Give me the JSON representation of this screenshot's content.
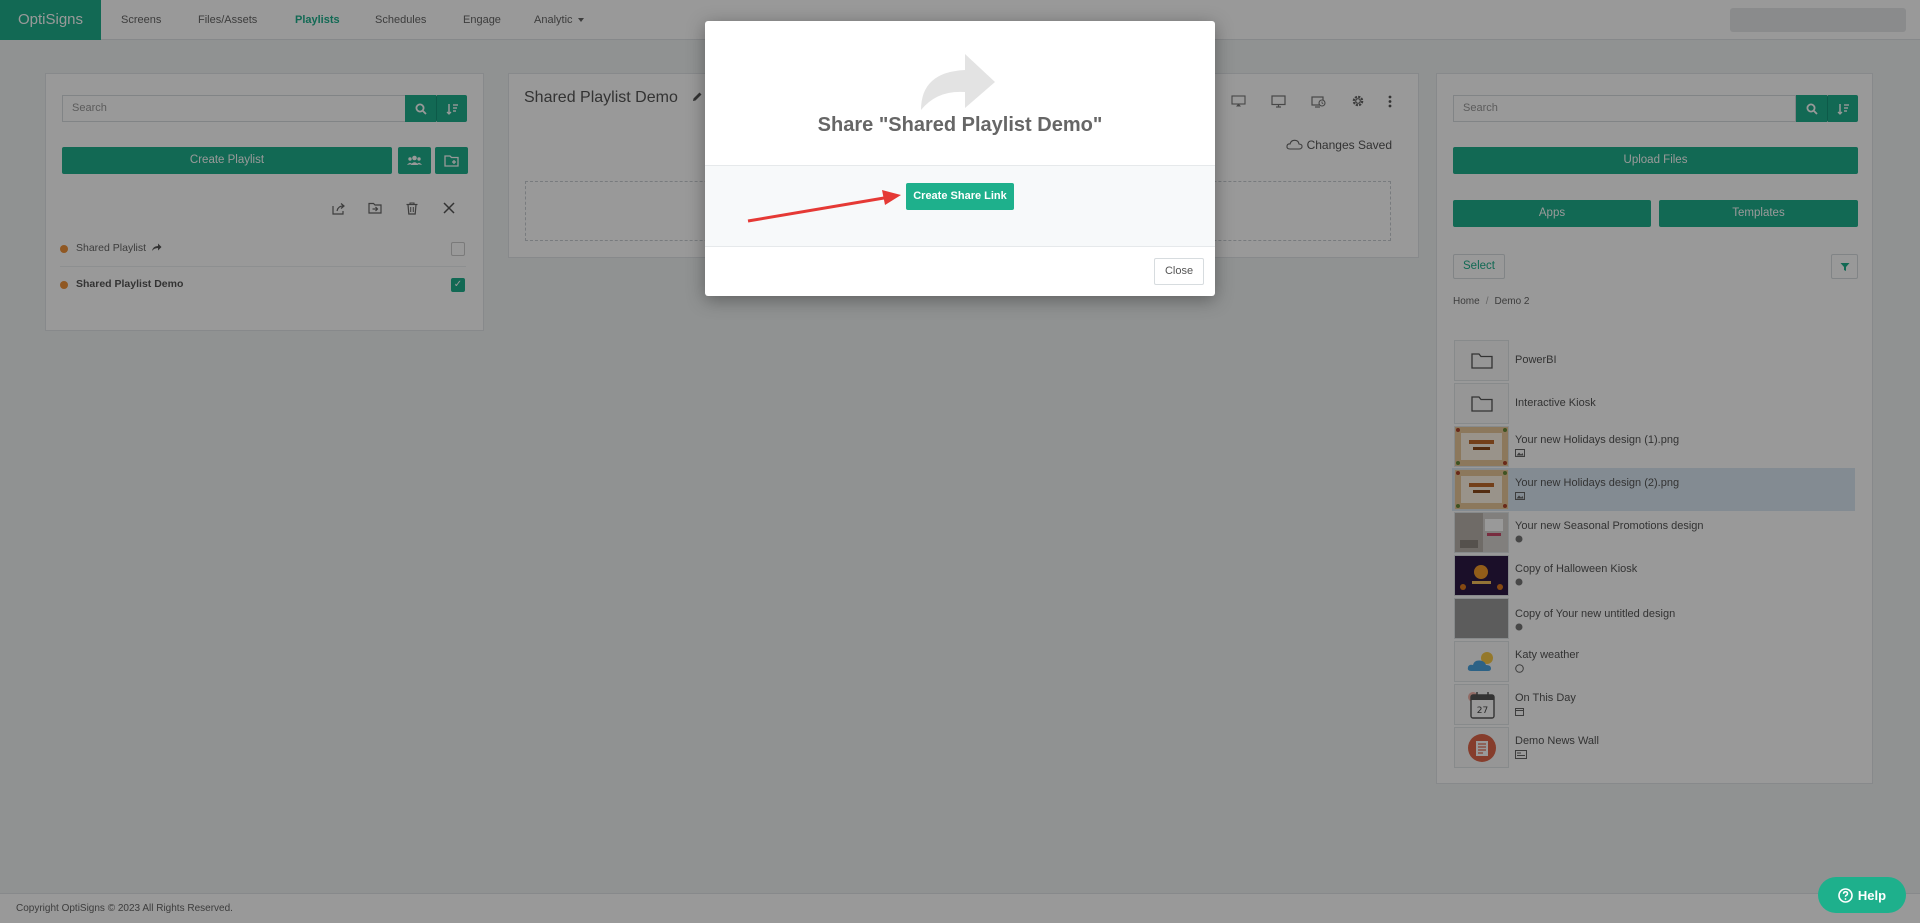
{
  "nav": {
    "brand": "OptiSigns",
    "items": [
      {
        "label": "Screens",
        "active": false
      },
      {
        "label": "Files/Assets",
        "active": false
      },
      {
        "label": "Playlists",
        "active": true
      },
      {
        "label": "Schedules",
        "active": false
      },
      {
        "label": "Engage",
        "active": false
      },
      {
        "label": "Analytic",
        "active": false
      }
    ]
  },
  "left_panel": {
    "search_placeholder": "Search",
    "create_button": "Create Playlist",
    "playlists": [
      {
        "name": "Shared Playlist",
        "shared_icon": "share-arrow-icon",
        "checked": false
      },
      {
        "name": "Shared Playlist Demo",
        "checked": true
      }
    ]
  },
  "middle_panel": {
    "title": "Shared Playlist Demo",
    "status": "Changes Saved"
  },
  "right_panel": {
    "search_placeholder": "Search",
    "upload_button": "Upload Files",
    "apps_button": "Apps",
    "templates_button": "Templates",
    "select_button": "Select",
    "breadcrumb": [
      "Home",
      "Demo 2"
    ],
    "assets": [
      {
        "name": "PowerBI",
        "type": "folder"
      },
      {
        "name": "Interactive Kiosk",
        "type": "folder"
      },
      {
        "name": "Your new Holidays design (1).png",
        "type": "image"
      },
      {
        "name": "Your new Holidays design (2).png",
        "type": "image",
        "highlighted": true
      },
      {
        "name": "Your new Seasonal Promotions design",
        "type": "design"
      },
      {
        "name": "Copy of Halloween Kiosk",
        "type": "design"
      },
      {
        "name": "Copy of Your new untitled design",
        "type": "design"
      },
      {
        "name": "Katy weather",
        "type": "weather-app"
      },
      {
        "name": "On This Day",
        "type": "calendar-app",
        "calendar_day": "27"
      },
      {
        "name": "Demo News Wall",
        "type": "news-app"
      }
    ]
  },
  "modal": {
    "title": "Share \"Shared Playlist Demo\"",
    "create_link_button": "Create Share Link",
    "close_button": "Close"
  },
  "footer": {
    "copyright": "Copyright OptiSigns © 2023 All Rights Reserved."
  },
  "help_button": "Help",
  "colors": {
    "accent": "#1eb08c",
    "status_dot": "#f0933b",
    "highlight_row": "#dbe8f4",
    "annotation_arrow": "#e53935"
  }
}
